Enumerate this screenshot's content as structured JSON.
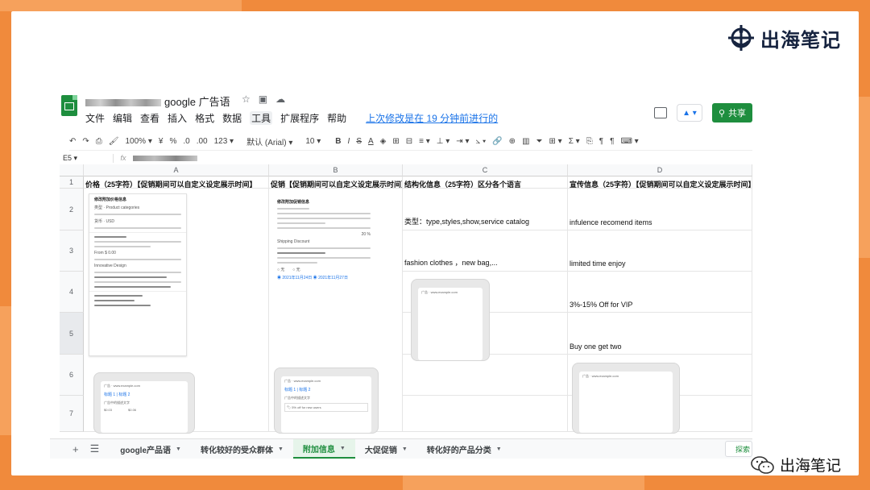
{
  "brand": {
    "title": "出海笔记"
  },
  "watermark": {
    "text": "出海笔记"
  },
  "doc": {
    "title": "google 广告语"
  },
  "menu": {
    "items": [
      "文件",
      "编辑",
      "查看",
      "插入",
      "格式",
      "数据",
      "工具",
      "扩展程序",
      "帮助"
    ],
    "last_edit": "上次修改是在 19 分钟前进行的"
  },
  "share_label": "共享",
  "toolbar": {
    "zoom": "100%",
    "currency": "¥",
    "percent": "%",
    "dec_less": ".0",
    "dec_more": ".00",
    "format_more": "123",
    "font": "默认 (Arial)",
    "font_size": "10",
    "bold": "B",
    "italic": "I",
    "strike": "S",
    "textcolor": "A"
  },
  "formula": {
    "cell_ref": "E5",
    "fx": "fx"
  },
  "columns": [
    "A",
    "B",
    "C",
    "D"
  ],
  "rows": [
    "1",
    "2",
    "3",
    "4",
    "5",
    "6",
    "7"
  ],
  "headers": [
    "价格（25字符）【促销期间可以自定义设定展示时间】",
    "促销【促销期间可以自定义设定展示时间】",
    "结构化信息（25字符）区分各个语言",
    "宣传信息（25字符）【促销期间可以自定义设定展示时间】"
  ],
  "cells": {
    "c2": "类型：type,styles,show,service catalog",
    "c3": "fashion clothes ，new bag,...",
    "d2": "infulence recomend items",
    "d3": "limited time enjoy",
    "d4": "3%-15% Off for VIP",
    "d5": "Buy one get two"
  },
  "shots": {
    "a_title": "修改附加价格信息",
    "a_type": "类型",
    "a_type_val": "Product categories",
    "a_currency": "货币",
    "a_currency_val": "USD",
    "a_from": "From",
    "a_from_val": "$ 0.00",
    "a_desc": "Innovative Design",
    "b_title": "修改附加促销信息",
    "b_promo": "Shipping Discount",
    "b_pct": "20 %",
    "b_date1": "2021年11月24日",
    "b_date2": "2021年11月27日",
    "b_none": "无",
    "ad_label": "广告",
    "ad_url": "www.example.com",
    "ad_headline": "标题 1 | 标题 2",
    "ad_desc": "广告中的描述文字",
    "ad_offer": "5% off for new users",
    "ad_price1": "$0.03",
    "ad_price2": "$0.06"
  },
  "tabs": [
    "google产品语",
    "转化较好的受众群体",
    "附加信息",
    "大促促销",
    "转化好的产品分类"
  ],
  "active_tab": "附加信息",
  "explore_label": "探索"
}
